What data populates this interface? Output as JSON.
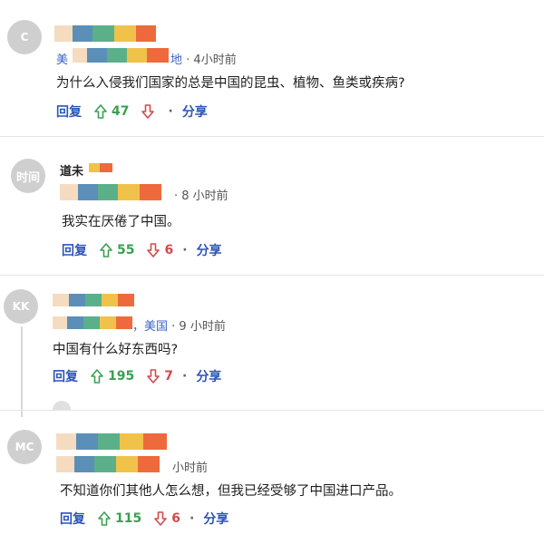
{
  "comments": [
    {
      "avatar_text": "C",
      "meta_loc_prefix": "美",
      "meta_loc_suffix": "地",
      "meta_time": "· 4小时前",
      "text": "为什么入侵我们国家的总是中国的昆虫、植物、鱼类或疾病?",
      "reply_label": "回复",
      "upvotes": "47",
      "downvotes": "",
      "share_label": "分享"
    },
    {
      "avatar_text": "时间",
      "name_visible": "道未",
      "meta_loc_prefix": "",
      "meta_loc_suffix": "",
      "meta_time": "· 8 小时前",
      "text": "我实在厌倦了中国。",
      "reply_label": "回复",
      "upvotes": "55",
      "downvotes": "6",
      "share_label": "分享"
    },
    {
      "avatar_text": "KK",
      "meta_loc_prefix": "",
      "meta_loc_suffix": "，美国",
      "meta_time": "· 9 小时前",
      "text": "中国有什么好东西吗?",
      "reply_label": "回复",
      "upvotes": "195",
      "downvotes": "7",
      "share_label": "分享"
    },
    {
      "avatar_text": "MC",
      "meta_loc_prefix": "",
      "meta_loc_suffix": "",
      "meta_time": "小时前",
      "text": "不知道你们其他人怎么想，但我已经受够了中国进口产品。",
      "reply_label": "回复",
      "upvotes": "115",
      "downvotes": "6",
      "share_label": "分享"
    }
  ],
  "dot_separator": "·",
  "colors": {
    "avatar_bg": "#cfcfcf",
    "reply": "#2d55b8",
    "upvote": "#3aa052",
    "downvote": "#d24a4a",
    "location": "#3b63c7",
    "pixel_strip": [
      "#f5d6b0",
      "#5b8fb8",
      "#5bb08a",
      "#f0c24a",
      "#ee6a3c"
    ]
  },
  "icons": [
    "up-arrow-icon",
    "down-arrow-icon"
  ]
}
